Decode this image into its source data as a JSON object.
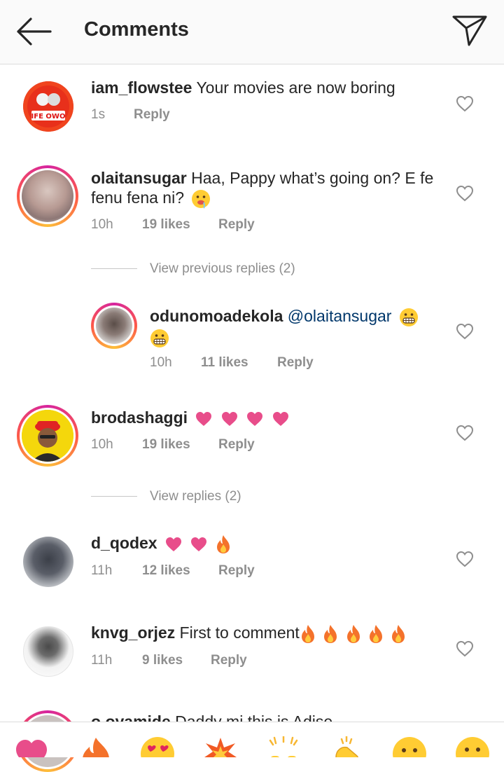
{
  "header": {
    "title": "Comments"
  },
  "comments": [
    {
      "username": "iam_flowstee",
      "text": "Your movies are now boring",
      "time": "1s",
      "reply": "Reply"
    },
    {
      "username": "olaitansugar",
      "text_line1": "Haa, Pappy what’s going on? E fe",
      "text_line2": "fenu fena ni?",
      "time": "10h",
      "likes": "19 likes",
      "reply": "Reply"
    },
    {
      "username": "odunomoadekola",
      "mention": "@olaitansugar",
      "time": "10h",
      "likes": "11 likes",
      "reply": "Reply"
    },
    {
      "username": "brodashaggi",
      "time": "10h",
      "likes": "19 likes",
      "reply": "Reply"
    },
    {
      "username": "d_qodex",
      "time": "11h",
      "likes": "12 likes",
      "reply": "Reply"
    },
    {
      "username": "knvg_orjez",
      "text": "First to comment",
      "time": "11h",
      "likes": "9 likes",
      "reply": "Reply"
    },
    {
      "username": "o.oyamide",
      "text": "Daddy mi this is Adise"
    }
  ],
  "threads": {
    "view_previous": "View previous replies (2)",
    "view_replies": "View replies (2)"
  },
  "avatar_badge": {
    "text": "IFE OWO"
  },
  "colors": {
    "heart_pink": "#e84d8a",
    "ring_gradient": [
      "#d6249f",
      "#fd5949",
      "#fdbe3a"
    ],
    "mention": "#00376b",
    "meta_gray": "#8e8e8e"
  }
}
